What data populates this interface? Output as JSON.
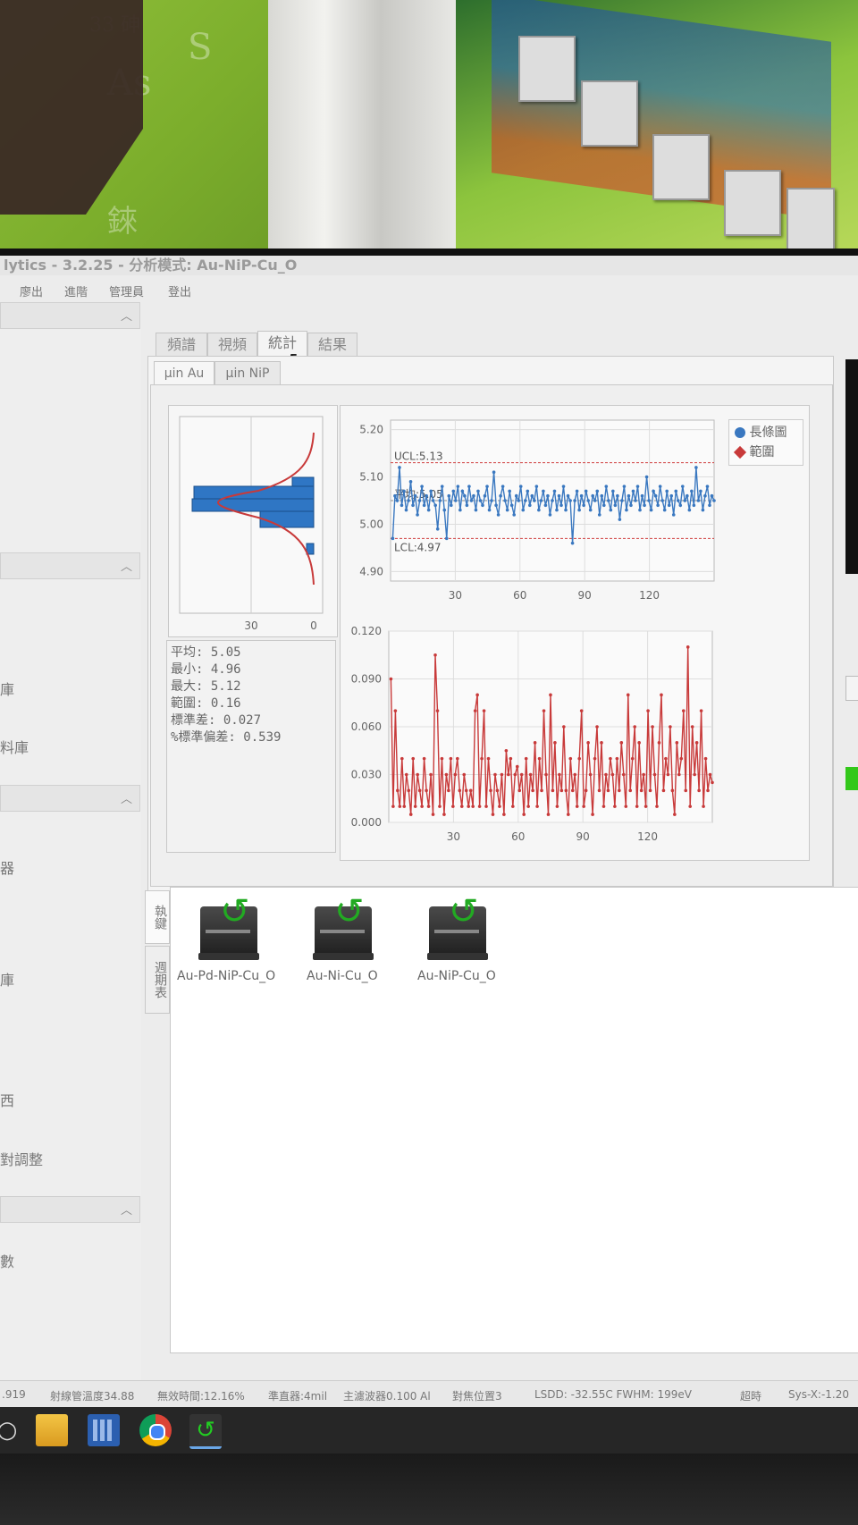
{
  "app": {
    "title": "lytics - 3.2.25 - 分析模式: Au-NiP-Cu_O"
  },
  "menu": [
    "廖出",
    "進階",
    "管理員",
    "登出"
  ],
  "left_pane": {
    "labels": [
      "庫",
      "料庫",
      "器",
      "庫",
      "西",
      "對調整",
      "數"
    ]
  },
  "tabs": [
    "頻譜",
    "視頻",
    "統計",
    "結果"
  ],
  "active_tab": "統計",
  "subtabs": [
    "µin Au",
    "µin NiP"
  ],
  "active_subtab": "µin Au",
  "stats": {
    "lines": [
      "平均: 5.05",
      "最小: 4.96",
      "最大: 5.12",
      "範圍: 0.16",
      "標準差: 0.027",
      "%標準偏差: 0.539"
    ]
  },
  "histogram": {
    "x_ticks": [
      "30",
      "0"
    ]
  },
  "legend": {
    "items": [
      {
        "label": "長條圖",
        "color": "#3a78c0"
      },
      {
        "label": "範圍",
        "color": "#c83a3a"
      }
    ]
  },
  "chart_data": [
    {
      "type": "line",
      "title": "",
      "x_ticks": [
        "30",
        "60",
        "90",
        "120"
      ],
      "y_ticks": [
        "5.20",
        "5.10",
        "5.00",
        "4.90"
      ],
      "ylim": [
        4.88,
        5.22
      ],
      "xlim": [
        0,
        150
      ],
      "annotations": {
        "ucl_label": "UCL:5.13",
        "mean_label": "平均:5.05",
        "lcl_label": "LCL:4.97"
      },
      "ucl": 5.13,
      "mean": 5.05,
      "lcl": 4.97,
      "series": [
        {
          "color": "#3a78c0",
          "values": [
            4.97,
            5.06,
            5.05,
            5.12,
            5.04,
            5.07,
            5.03,
            5.05,
            5.09,
            5.04,
            5.06,
            5.02,
            5.05,
            5.08,
            5.04,
            5.06,
            5.03,
            5.07,
            5.05,
            5.04,
            4.99,
            5.05,
            5.08,
            5.03,
            4.97,
            5.06,
            5.04,
            5.07,
            5.05,
            5.08,
            5.03,
            5.07,
            5.06,
            5.04,
            5.08,
            5.05,
            5.06,
            5.03,
            5.07,
            5.05,
            5.04,
            5.06,
            5.08,
            5.03,
            5.05,
            5.11,
            5.04,
            5.02,
            5.06,
            5.08,
            5.05,
            5.03,
            5.07,
            5.04,
            5.02,
            5.06,
            5.05,
            5.08,
            5.03,
            5.05,
            5.07,
            5.04,
            5.06,
            5.05,
            5.08,
            5.03,
            5.05,
            5.07,
            5.04,
            5.06,
            5.02,
            5.05,
            5.07,
            5.03,
            5.06,
            5.04,
            5.08,
            5.03,
            5.06,
            5.05,
            4.96,
            5.05,
            5.07,
            5.03,
            5.06,
            5.04,
            5.07,
            5.05,
            5.03,
            5.06,
            5.05,
            5.07,
            5.02,
            5.06,
            5.04,
            5.08,
            5.05,
            5.03,
            5.07,
            5.04,
            5.06,
            5.01,
            5.05,
            5.08,
            5.03,
            5.06,
            5.04,
            5.07,
            5.05,
            5.08,
            5.03,
            5.06,
            5.04,
            5.1,
            5.05,
            5.03,
            5.07,
            5.06,
            5.04,
            5.08,
            5.05,
            5.03,
            5.07,
            5.04,
            5.06,
            5.02,
            5.07,
            5.05,
            5.04,
            5.08,
            5.05,
            5.06,
            5.03,
            5.07,
            5.04,
            5.12,
            5.05,
            5.07,
            5.03,
            5.06,
            5.08,
            5.04,
            5.06,
            5.05
          ]
        }
      ]
    },
    {
      "type": "line",
      "title": "",
      "x_ticks": [
        "30",
        "60",
        "90",
        "120"
      ],
      "y_ticks": [
        "0.120",
        "0.090",
        "0.060",
        "0.030",
        "0.000"
      ],
      "ylim": [
        0,
        0.12
      ],
      "xlim": [
        0,
        150
      ],
      "series": [
        {
          "color": "#c83a3a",
          "values": [
            0.09,
            0.01,
            0.07,
            0.02,
            0.01,
            0.04,
            0.01,
            0.03,
            0.02,
            0.005,
            0.04,
            0.01,
            0.03,
            0.02,
            0.01,
            0.04,
            0.02,
            0.01,
            0.03,
            0.005,
            0.105,
            0.07,
            0.01,
            0.04,
            0.005,
            0.03,
            0.02,
            0.04,
            0.01,
            0.03,
            0.04,
            0.02,
            0.01,
            0.03,
            0.02,
            0.01,
            0.02,
            0.01,
            0.07,
            0.08,
            0.01,
            0.04,
            0.07,
            0.01,
            0.04,
            0.02,
            0.005,
            0.03,
            0.02,
            0.01,
            0.03,
            0.005,
            0.045,
            0.03,
            0.04,
            0.01,
            0.03,
            0.035,
            0.02,
            0.03,
            0.005,
            0.04,
            0.01,
            0.03,
            0.02,
            0.05,
            0.01,
            0.04,
            0.02,
            0.07,
            0.03,
            0.005,
            0.08,
            0.02,
            0.05,
            0.01,
            0.03,
            0.02,
            0.06,
            0.02,
            0.005,
            0.04,
            0.02,
            0.03,
            0.01,
            0.04,
            0.07,
            0.01,
            0.02,
            0.05,
            0.03,
            0.005,
            0.04,
            0.06,
            0.02,
            0.05,
            0.01,
            0.03,
            0.02,
            0.04,
            0.03,
            0.01,
            0.04,
            0.02,
            0.05,
            0.03,
            0.01,
            0.08,
            0.02,
            0.04,
            0.06,
            0.01,
            0.05,
            0.02,
            0.03,
            0.01,
            0.07,
            0.02,
            0.06,
            0.03,
            0.01,
            0.05,
            0.08,
            0.02,
            0.04,
            0.03,
            0.06,
            0.02,
            0.005,
            0.05,
            0.03,
            0.04,
            0.07,
            0.02,
            0.11,
            0.01,
            0.06,
            0.03,
            0.05,
            0.02,
            0.07,
            0.01,
            0.04,
            0.02,
            0.03,
            0.025
          ]
        }
      ]
    }
  ],
  "bottom": {
    "side_tabs": [
      "執鍵",
      "週期表"
    ],
    "devices": [
      {
        "label": "Au-Pd-NiP-Cu_O"
      },
      {
        "label": "Au-Ni-Cu_O"
      },
      {
        "label": "Au-NiP-Cu_O"
      }
    ]
  },
  "statusbar": {
    "items": [
      ".919",
      "射線管溫度34.88",
      "無效時間:12.16%",
      "準直器:4mil",
      "主濾波器0.100 Al",
      "對焦位置3",
      "LSDD: -32.55C FWHM: 199eV",
      "超時",
      "Sys-X:-1.20"
    ]
  },
  "taskbar": {
    "icons": [
      "power-icon",
      "folder-icon",
      "calculator-icon",
      "chrome-icon",
      "app-icon"
    ]
  }
}
